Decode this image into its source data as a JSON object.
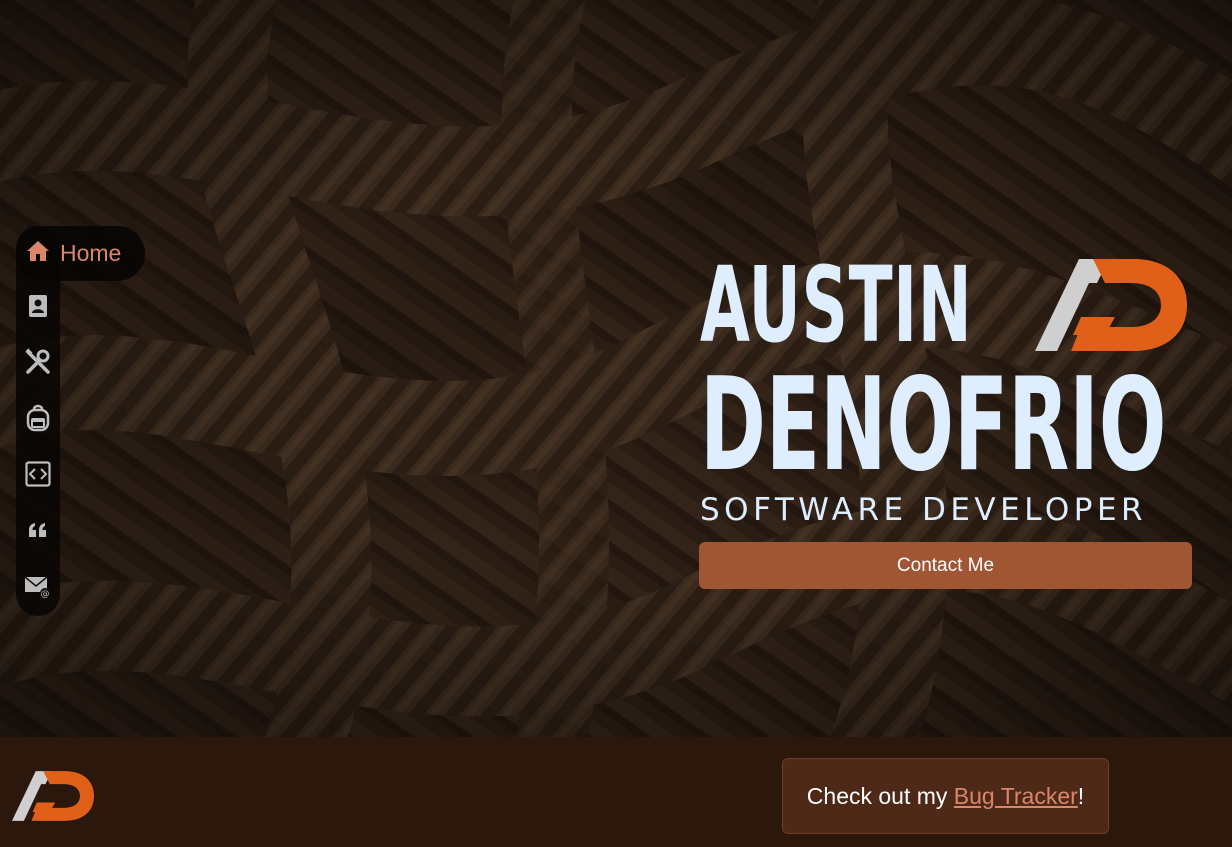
{
  "nav": {
    "home_label": "Home",
    "items": [
      {
        "icon": "contact-card-icon"
      },
      {
        "icon": "tools-icon"
      },
      {
        "icon": "backpack-icon"
      },
      {
        "icon": "code-icon"
      },
      {
        "icon": "quote-icon"
      },
      {
        "icon": "mail-icon"
      }
    ]
  },
  "hero": {
    "first_name": "AUSTIN",
    "last_name": "DENOFRIO",
    "role": "SOFTWARE DEVELOPER",
    "contact_button": "Contact Me",
    "logo_letters": "AD"
  },
  "footer": {
    "promo_prefix": "Check out my ",
    "promo_link": "Bug Tracker",
    "promo_suffix": "!"
  },
  "colors": {
    "accent": "#a05533",
    "accent_light": "#d9866a",
    "logo_orange": "#e0601a",
    "logo_grey": "#cfcfcf",
    "title_text": "#dfeeff",
    "footer_bg": "#2c170d"
  }
}
